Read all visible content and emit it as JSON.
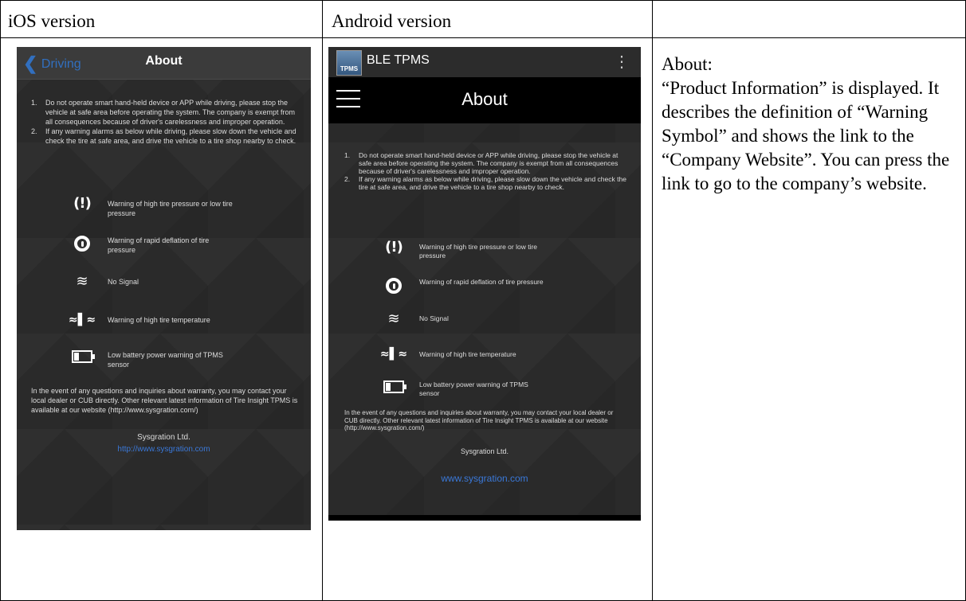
{
  "table": {
    "headers": [
      "iOS version",
      "Android version",
      ""
    ],
    "description": "About:\n“Product Information” is displayed. It describes the definition of “Warning Symbol” and shows the link to the “Company Website”. You can press the link to go to the company’s website."
  },
  "ios": {
    "back_label": "Driving",
    "title": "About",
    "notes": [
      {
        "num": "1.",
        "text": "Do not operate smart hand-held device or APP while driving, please stop the vehicle at safe area before operating the system. The company is exempt from all consequences because of driver's carelessness and improper operation."
      },
      {
        "num": "2.",
        "text": "If any warning alarms as below while driving, please slow down the vehicle and check the tire at safe area, and drive the vehicle to a tire shop nearby to check."
      }
    ],
    "warnings": [
      {
        "icon": "tire-pressure-warning-icon",
        "text": "Warning of high tire pressure or low tire pressure"
      },
      {
        "icon": "rapid-deflation-icon",
        "text": "Warning of rapid deflation of tire pressure"
      },
      {
        "icon": "no-signal-icon",
        "text": "No Signal"
      },
      {
        "icon": "high-temperature-icon",
        "text": "Warning of high tire temperature"
      },
      {
        "icon": "low-battery-icon",
        "text": "Low battery power warning of TPMS sensor"
      }
    ],
    "footer": "In the event of any questions and inquiries about warranty, you may contact your local dealer or CUB directly. Other relevant latest information of Tire Insight TPMS is available at our website (http://www.sysgration.com/)",
    "company": "Sysgration Ltd.",
    "link": "http://www.sysgration.com"
  },
  "android": {
    "app_name": "BLE TPMS",
    "logo_text": "TPMS",
    "title": "About",
    "notes": [
      {
        "num": "1.",
        "text": "Do not operate smart hand-held device or APP while driving, please stop the vehicle at safe area before operating the system. The company is exempt from all consequences because of driver's carelessness and improper operation."
      },
      {
        "num": "2.",
        "text": "If any warning alarms as below while driving, please slow down the vehicle and check the tire at safe area, and drive the vehicle to a tire shop nearby to check."
      }
    ],
    "warnings": [
      {
        "icon": "tire-pressure-warning-icon",
        "text": "Warning of high tire pressure or low tire pressure"
      },
      {
        "icon": "rapid-deflation-icon",
        "text": "Warning of rapid deflation of tire pressure"
      },
      {
        "icon": "no-signal-icon",
        "text": "No Signal"
      },
      {
        "icon": "high-temperature-icon",
        "text": "Warning of high tire temperature"
      },
      {
        "icon": "low-battery-icon",
        "text": "Low battery power warning of TPMS sensor"
      }
    ],
    "footer": "In the event of any questions and inquiries about warranty, you may contact your local dealer or CUB directly. Other relevant latest information of Tire Insight TPMS is available at our website (http://www.sysgration.com/)",
    "company": "Sysgration Ltd.",
    "link": "www.sysgration.com"
  },
  "colors": {
    "screen_bg": "#2a2a2a",
    "link": "#3a78d8",
    "ios_back": "#2f7de1"
  }
}
